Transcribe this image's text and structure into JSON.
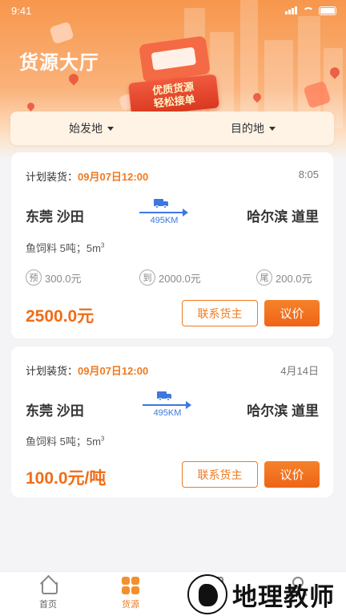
{
  "status_bar": {
    "time": "9:41"
  },
  "header": {
    "title": "货源大厅",
    "badge_line1": "优质货源",
    "badge_line2": "轻松接单"
  },
  "filters": {
    "origin_label": "始发地",
    "destination_label": "目的地"
  },
  "cards": [
    {
      "plan_label": "计划装货：",
      "plan_time": "09月07日12:00",
      "posted": "8:05",
      "from": "东莞  沙田",
      "to": "哈尔滨  道里",
      "distance": "495KM",
      "goods": "鱼饲料   5吨；5m",
      "goods_sup": "3",
      "payments": [
        {
          "icon": "预",
          "amount": "300.0元"
        },
        {
          "icon": "到",
          "amount": "2000.0元"
        },
        {
          "icon": "尾",
          "amount": "200.0元"
        }
      ],
      "price": "2500.0元",
      "contact_label": "联系货主",
      "negotiate_label": "议价"
    },
    {
      "plan_label": "计划装货：",
      "plan_time": "09月07日12:00",
      "posted": "4月14日",
      "from": "东莞  沙田",
      "to": "哈尔滨  道里",
      "distance": "495KM",
      "goods": "鱼饲料   5吨；5m",
      "goods_sup": "3",
      "price": "100.0元/吨",
      "contact_label": "联系货主",
      "negotiate_label": "议价"
    }
  ],
  "tabbar": {
    "items": [
      {
        "label": "首页",
        "icon": "home-icon"
      },
      {
        "label": "货源",
        "icon": "grid-icon"
      },
      {
        "label": "",
        "icon": "document-icon"
      },
      {
        "label": "",
        "icon": "user-icon"
      }
    ],
    "active_color": "#f07a1f"
  },
  "watermark": {
    "text": "地理教师"
  },
  "colors": {
    "accent": "#f07a1f",
    "route": "#3d78e0",
    "hero": "#f7974d"
  }
}
